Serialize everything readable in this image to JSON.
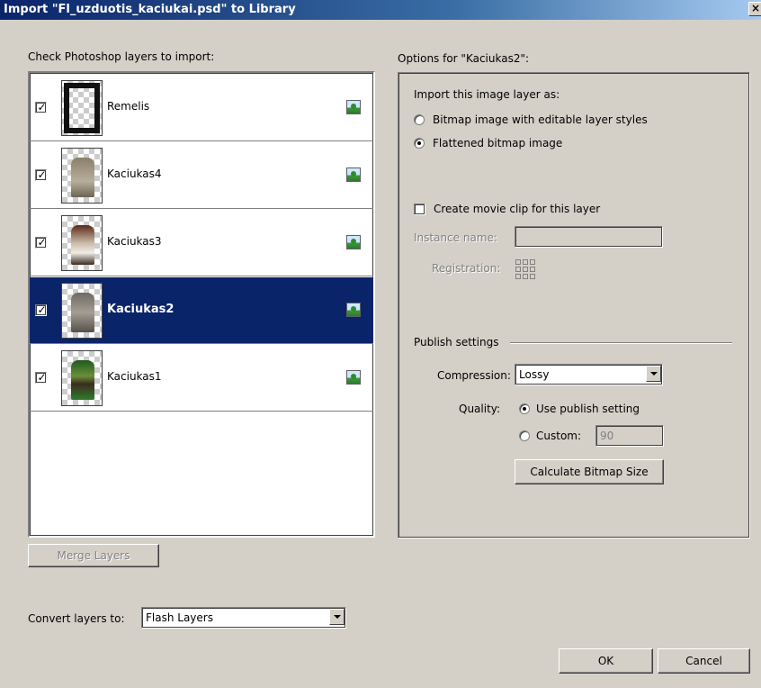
{
  "dialog": {
    "title": "Import \"Fl_uzduotis_kaciukai.psd\" to Library",
    "close_glyph": "×"
  },
  "layers_panel": {
    "label": "Check Photoshop layers to import:",
    "layers": [
      {
        "name": "Remelis",
        "checked": true,
        "selected": false
      },
      {
        "name": "Kaciukas4",
        "checked": true,
        "selected": false
      },
      {
        "name": "Kaciukas3",
        "checked": true,
        "selected": false
      },
      {
        "name": "Kaciukas2",
        "checked": true,
        "selected": true
      },
      {
        "name": "Kaciukas1",
        "checked": true,
        "selected": false
      }
    ],
    "merge_button": "Merge Layers"
  },
  "options": {
    "label": "Options for \"Kaciukas2\":",
    "import_as_label": "Import this image layer as:",
    "radio_bitmap_editable": "Bitmap image with editable layer styles",
    "radio_flattened": "Flattened bitmap image",
    "movie_clip_label": "Create movie clip for this layer",
    "movie_clip_checked": false,
    "instance_name_label": "Instance name:",
    "instance_name_value": "",
    "registration_label": "Registration:",
    "publish_settings_label": "Publish settings",
    "compression_label": "Compression:",
    "compression_value": "Lossy",
    "quality_label": "Quality:",
    "radio_use_publish": "Use publish setting",
    "radio_custom": "Custom:",
    "custom_value": "90",
    "calculate_button": "Calculate Bitmap Size"
  },
  "footer": {
    "convert_label": "Convert layers to:",
    "convert_value": "Flash Layers",
    "ok_button": "OK",
    "cancel_button": "Cancel"
  },
  "check_glyph": "✓"
}
